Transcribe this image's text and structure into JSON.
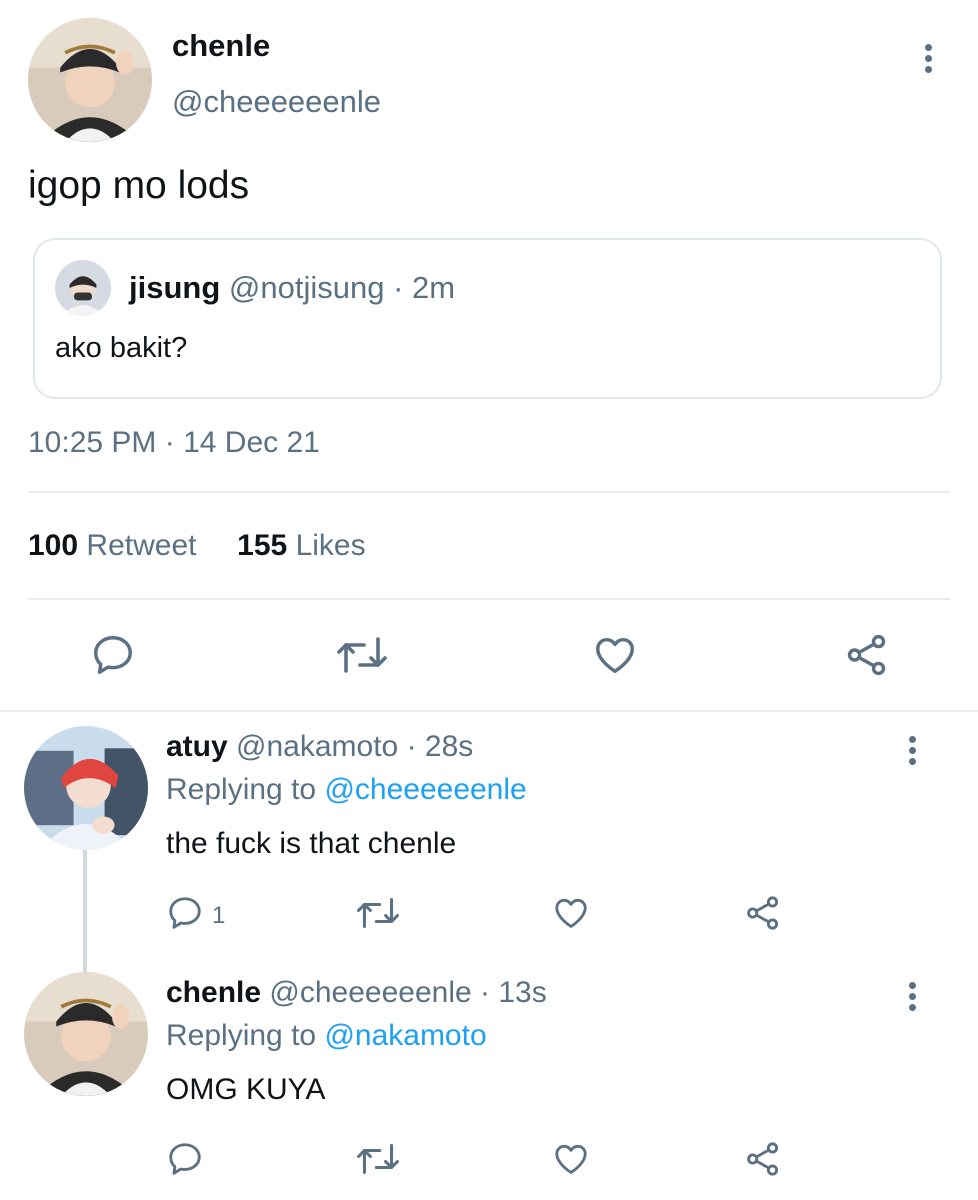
{
  "main_tweet": {
    "display_name": "chenle",
    "handle": "@cheeeeeenle",
    "text": "igop mo lods",
    "quoted": {
      "display_name": "jisung",
      "handle": "@notjisung",
      "sep": "·",
      "time": "2m",
      "text": "ako bakit?"
    },
    "timestamp": "10:25 PM · 14 Dec 21",
    "stats": {
      "retweets_count": "100",
      "retweets_label": "Retweet",
      "likes_count": "155",
      "likes_label": "Likes"
    }
  },
  "replies": [
    {
      "display_name": "atuy",
      "handle": "@nakamoto",
      "time": "· 28s",
      "replying_label": "Replying to",
      "replying_to": "@cheeeeeenle",
      "text": "the fuck is that chenle",
      "reply_count": "1"
    },
    {
      "display_name": "chenle",
      "handle": "@cheeeeeenle",
      "time": "· 13s",
      "replying_label": "Replying to",
      "replying_to": "@nakamoto",
      "text": "OMG KUYA",
      "reply_count": ""
    }
  ],
  "icons": [
    "more-vertical-icon",
    "reply-icon",
    "retweet-icon",
    "like-icon",
    "share-icon"
  ],
  "colors": {
    "text": "#0f1419",
    "muted": "#5b7083",
    "link": "#1da1f2",
    "divider": "#e6ecf0"
  }
}
